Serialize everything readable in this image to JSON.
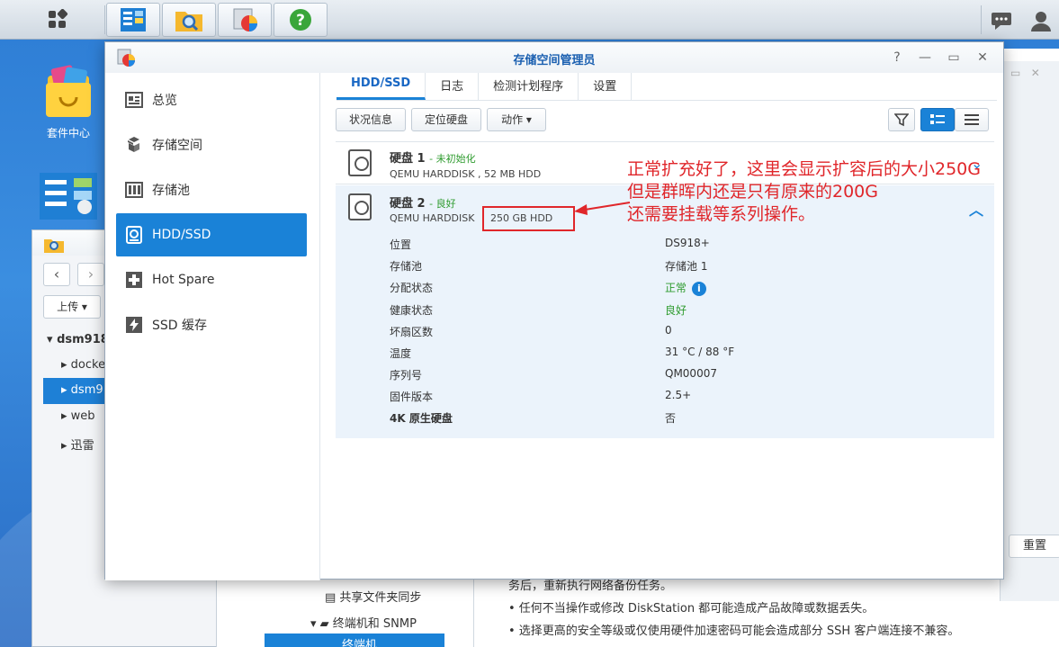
{
  "desktop": {
    "package_center_label": "套件中心"
  },
  "background_left": {
    "upload_label": "上传 ▾",
    "tree": [
      "dsm918",
      "docke",
      "dsm9",
      "web",
      "迅雷"
    ]
  },
  "background_right": {
    "reset_label": "重置",
    "sync_label": "共享文件夹同步",
    "snmp_label": "终端机和 SNMP",
    "selected_label": "终端机",
    "text_line_0": "务后，重新执行网络备份任务。",
    "text_line_1": "• 任何不当操作或修改 DiskStation 都可能造成产品故障或数据丢失。",
    "text_line_2": "• 选择更高的安全等级或仅使用硬件加速密码可能会造成部分 SSH 客户端连接不兼容。"
  },
  "window": {
    "title": "存储空间管理员",
    "sidebar": [
      {
        "label": "总览",
        "icon": "overview-icon"
      },
      {
        "label": "存储空间",
        "icon": "volume-icon"
      },
      {
        "label": "存储池",
        "icon": "storage-pool-icon"
      },
      {
        "label": "HDD/SSD",
        "icon": "hdd-icon"
      },
      {
        "label": "Hot Spare",
        "icon": "hot-spare-icon"
      },
      {
        "label": "SSD 缓存",
        "icon": "ssd-cache-icon"
      }
    ],
    "tabs": [
      "HDD/SSD",
      "日志",
      "检测计划程序",
      "设置"
    ],
    "toolbar": {
      "status_info": "状况信息",
      "locate_disk": "定位硬盘",
      "action": "动作 ▾"
    },
    "disks": [
      {
        "name": "硬盘 1",
        "status": "- 未初始化",
        "model": "QEMU HARDDISK , 52 MB HDD"
      },
      {
        "name": "硬盘 2",
        "status": "- 良好",
        "model": "QEMU HARDDISK",
        "size": "250 GB HDD"
      }
    ],
    "disk2_props": [
      {
        "label": "位置",
        "value": "DS918+"
      },
      {
        "label": "存储池",
        "value": "存储池 1"
      },
      {
        "label": "分配状态",
        "value": "正常"
      },
      {
        "label": "健康状态",
        "value": "良好"
      },
      {
        "label": "坏扇区数",
        "value": "0"
      },
      {
        "label": "温度",
        "value": "31 °C / 88 °F"
      },
      {
        "label": "序列号",
        "value": "QM00007"
      },
      {
        "label": "固件版本",
        "value": "2.5+"
      },
      {
        "label": "4K 原生硬盘",
        "value": "否"
      }
    ]
  },
  "annotation": {
    "line1": "正常扩充好了，这里会显示扩容后的大小250G",
    "line2": "但是群晖内还是只有原来的200G",
    "line3": "还需要挂载等系列操作。"
  },
  "colors": {
    "accent": "#1a82d7",
    "annotation_red": "#e0262a",
    "status_green": "#2e9b2e"
  }
}
